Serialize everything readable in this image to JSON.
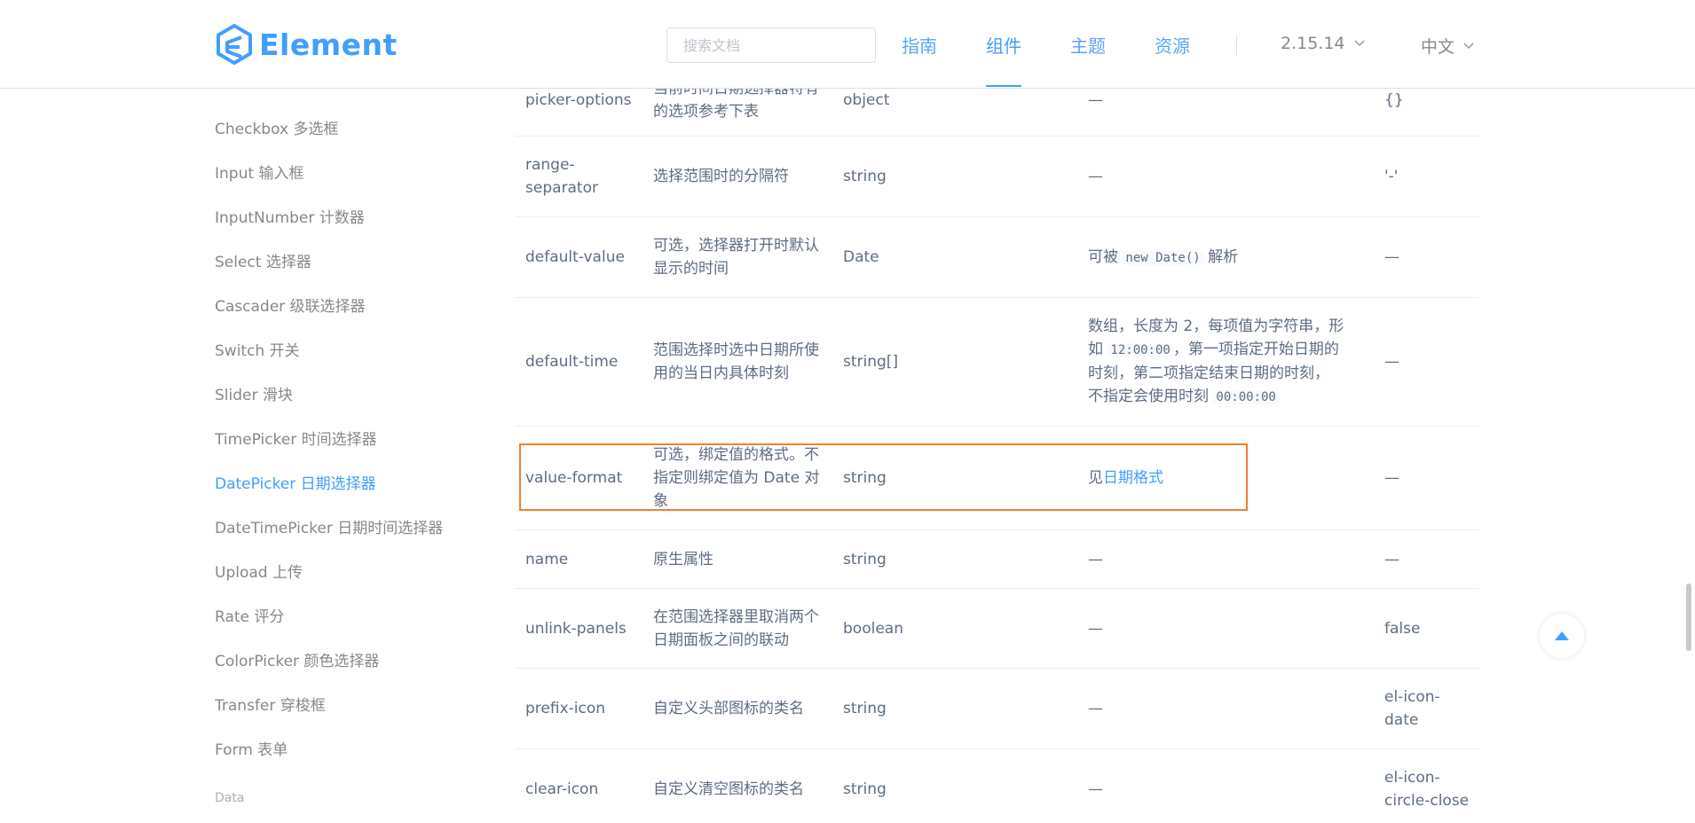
{
  "header": {
    "logo_text": "Element",
    "search_placeholder": "搜索文档",
    "nav": [
      {
        "label": "指南",
        "active": false
      },
      {
        "label": "组件",
        "active": true
      },
      {
        "label": "主题",
        "active": false
      },
      {
        "label": "资源",
        "active": false
      }
    ],
    "version": "2.15.14",
    "language": "中文",
    "accent": "#409eff"
  },
  "sidebar": {
    "items": [
      {
        "label": "Checkbox 多选框",
        "active": false
      },
      {
        "label": "Input 输入框",
        "active": false
      },
      {
        "label": "InputNumber 计数器",
        "active": false
      },
      {
        "label": "Select 选择器",
        "active": false
      },
      {
        "label": "Cascader 级联选择器",
        "active": false
      },
      {
        "label": "Switch 开关",
        "active": false
      },
      {
        "label": "Slider 滑块",
        "active": false
      },
      {
        "label": "TimePicker 时间选择器",
        "active": false
      },
      {
        "label": "DatePicker 日期选择器",
        "active": true
      },
      {
        "label": "DateTimePicker 日期时间选择器",
        "active": false
      },
      {
        "label": "Upload 上传",
        "active": false
      },
      {
        "label": "Rate 评分",
        "active": false
      },
      {
        "label": "ColorPicker 颜色选择器",
        "active": false
      },
      {
        "label": "Transfer 穿梭框",
        "active": false
      },
      {
        "label": "Form 表单",
        "active": false
      }
    ],
    "group_label": "Data"
  },
  "table": {
    "rows": [
      {
        "attr": "picker-options",
        "desc": "当前时间日期选择器特有的选项参考下表",
        "type": "object",
        "values": "—",
        "default": "{}"
      },
      {
        "attr": "range-separator",
        "desc": "选择范围时的分隔符",
        "type": "string",
        "values": "—",
        "default": "'-'"
      },
      {
        "attr": "default-value",
        "desc": "可选，选择器打开时默认显示的时间",
        "type": "Date",
        "values_pre": "可被",
        "values_code": "new Date()",
        "values_post": "解析",
        "default": "—"
      },
      {
        "attr": "default-time",
        "desc": "范围选择时选中日期所使用的当日内具体时刻",
        "type": "string[]",
        "values_l1": "数组，长度为 2，每项值为字符串，形",
        "values_l2_pre": "如",
        "values_l2_code": "12:00:00",
        "values_l2_post": "，第一项指定开始日期的",
        "values_l3": "时刻，第二项指定结束日期的时刻，",
        "values_l4_pre": "不指定会使用时刻",
        "values_l4_code": "00:00:00",
        "default": "—"
      },
      {
        "attr": "value-format",
        "desc": "可选，绑定值的格式。不指定则绑定值为 Date 对象",
        "type": "string",
        "values_pre": "见",
        "values_link": "日期格式",
        "default": "—"
      },
      {
        "attr": "name",
        "desc": "原生属性",
        "type": "string",
        "values": "—",
        "default": "—"
      },
      {
        "attr": "unlink-panels",
        "desc": "在范围选择器里取消两个日期面板之间的联动",
        "type": "boolean",
        "values": "—",
        "default": "false"
      },
      {
        "attr": "prefix-icon",
        "desc": "自定义头部图标的类名",
        "type": "string",
        "values": "—",
        "default": "el-icon-date"
      },
      {
        "attr": "clear-icon",
        "desc": "自定义清空图标的类名",
        "type": "string",
        "values": "—",
        "default": "el-icon-circle-close"
      }
    ]
  },
  "highlight_color": "#f0822e"
}
